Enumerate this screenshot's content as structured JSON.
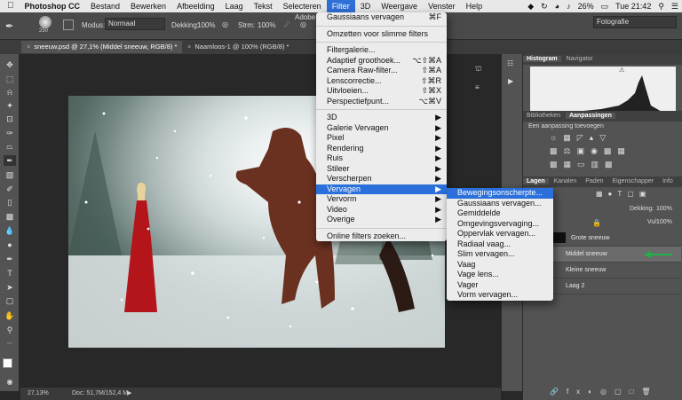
{
  "menubar": {
    "apple": "",
    "app": "Photoshop CC",
    "items": [
      "Bestand",
      "Bewerken",
      "Afbeelding",
      "Laag",
      "Tekst",
      "Selecteren",
      "Filter",
      "3D",
      "Weergave",
      "Venster",
      "Help"
    ],
    "battery": "26%",
    "clock": "Tue 21:42",
    "window_title_fragment": "Adobe"
  },
  "optbar": {
    "brush_size": "250",
    "mode_label": "Modus:",
    "mode_value": "Normaal",
    "opacity_label": "Dekking:",
    "opacity_value": "100%",
    "flow_label": "Strm:",
    "flow_value": "100%",
    "workspace": "Fotografie"
  },
  "tabs": [
    {
      "label": "sneeuw.psd @ 27,1% (Middel sneeuw, RGB/8) *"
    },
    {
      "label": "Naamloos-1 @ 100% (RGB/8) *"
    }
  ],
  "status": {
    "zoom": "27,13%",
    "doc": "Doc: 51,7M/152,4 M"
  },
  "panels": {
    "histogram_tabs": [
      "Histogram",
      "Navigator"
    ],
    "adjust_tabs": [
      "Bibliotheken",
      "Aanpassingen"
    ],
    "adjust_hint": "Een aanpassing toevoegen",
    "layers_tabs": [
      "Lagen",
      "Kanalen",
      "Paden",
      "Eigenschapper",
      "Info"
    ],
    "opacity_label": "Dekking:",
    "opacity_value": "100%",
    "fill_label": "Vul:",
    "fill_value": "100%",
    "layers": [
      "Grote sneeuw",
      "Middel sneeuw",
      "Kleine sneeuw",
      "Laag 2"
    ]
  },
  "filter_menu": {
    "items": [
      {
        "label": "Gaussiaans vervagen",
        "shortcut": "⌘F"
      },
      {
        "sep": true
      },
      {
        "label": "Omzetten voor slimme filters",
        "shortcut": ""
      },
      {
        "sep": true
      },
      {
        "label": "Filtergalerie...",
        "shortcut": ""
      },
      {
        "label": "Adaptief groothoek...",
        "shortcut": "⌥⇧⌘A"
      },
      {
        "label": "Camera Raw-filter...",
        "shortcut": "⇧⌘A"
      },
      {
        "label": "Lenscorrectie...",
        "shortcut": "⇧⌘R"
      },
      {
        "label": "Uitvloeien...",
        "shortcut": "⇧⌘X"
      },
      {
        "label": "Perspectiefpunt...",
        "shortcut": "⌥⌘V"
      },
      {
        "sep": true
      },
      {
        "label": "3D",
        "shortcut": "▶"
      },
      {
        "label": "Galerie Vervagen",
        "shortcut": "▶"
      },
      {
        "label": "Pixel",
        "shortcut": "▶"
      },
      {
        "label": "Rendering",
        "shortcut": "▶"
      },
      {
        "label": "Ruis",
        "shortcut": "▶"
      },
      {
        "label": "Stileer",
        "shortcut": "▶"
      },
      {
        "label": "Verscherpen",
        "shortcut": "▶"
      },
      {
        "label": "Vervagen",
        "shortcut": "▶",
        "highlight": true
      },
      {
        "label": "Vervorm",
        "shortcut": "▶"
      },
      {
        "label": "Video",
        "shortcut": "▶"
      },
      {
        "label": "Overige",
        "shortcut": "▶"
      },
      {
        "sep": true
      },
      {
        "label": "Online filters zoeken...",
        "shortcut": ""
      }
    ]
  },
  "blur_submenu": {
    "items": [
      {
        "label": "Bewegingsonscherpte...",
        "highlight": true
      },
      {
        "label": "Gaussiaans vervagen..."
      },
      {
        "label": "Gemiddelde"
      },
      {
        "label": "Omgevingsvervaging..."
      },
      {
        "label": "Oppervlak vervagen..."
      },
      {
        "label": "Radiaal vaag..."
      },
      {
        "label": "Slim vervagen..."
      },
      {
        "label": "Vaag"
      },
      {
        "label": "Vage lens..."
      },
      {
        "label": "Vager"
      },
      {
        "label": "Vorm vervagen..."
      }
    ]
  },
  "colors": {
    "menu_highlight": "#2a6fda",
    "arrow_green": "#22b04a"
  }
}
